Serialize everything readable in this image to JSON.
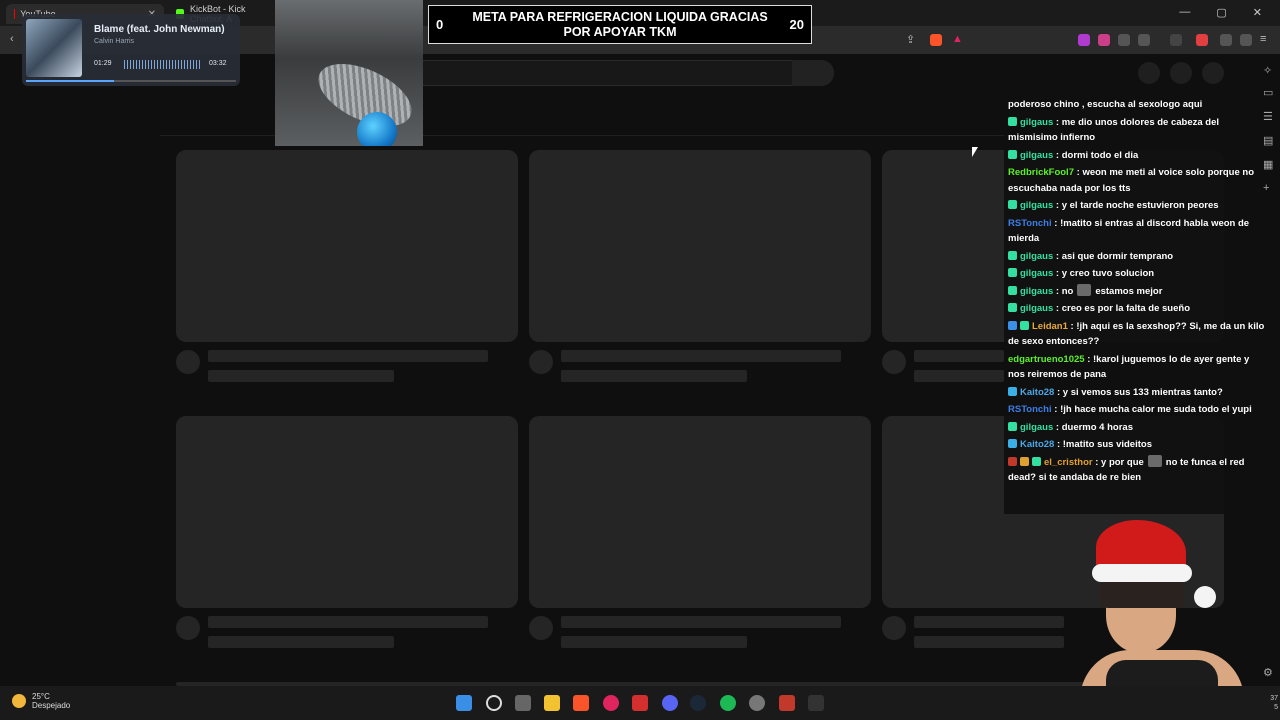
{
  "browser": {
    "tabs": [
      {
        "label": "YouTube",
        "color": "#ff0000"
      },
      {
        "label": "KickBot - Kick Chatbot, A",
        "color": "#53fc18"
      }
    ],
    "window_controls": [
      "—",
      "▢",
      "✕"
    ]
  },
  "music": {
    "title": "Blame (feat. John Newman)",
    "artist": "Calvin Harris",
    "elapsed": "01:29",
    "duration": "03:32",
    "progress": 0.42
  },
  "goal": {
    "current": "0",
    "target": "20",
    "text": "META PARA REFRIGERACION LIQUIDA GRACIAS POR APOYAR TKM"
  },
  "chat": [
    {
      "user": "",
      "color": "#ffffff",
      "badges": [],
      "text": "poderoso chino , escucha al sexologo aqui"
    },
    {
      "user": "gilgaus",
      "color": "#34e0a1",
      "badges": [
        "#34e0a1"
      ],
      "text": " : me dio unos dolores de cabeza del mismisimo infierno"
    },
    {
      "user": "gilgaus",
      "color": "#34e0a1",
      "badges": [
        "#34e0a1"
      ],
      "text": " : dormi todo el dia"
    },
    {
      "user": "RedbrickFool7",
      "color": "#5cf02b",
      "badges": [],
      "text": " : weon me meti al voice solo porque no escuchaba nada por los tts"
    },
    {
      "user": "gilgaus",
      "color": "#34e0a1",
      "badges": [
        "#34e0a1"
      ],
      "text": " : y el tarde noche estuvieron peores"
    },
    {
      "user": "RSTonchi",
      "color": "#3b7fe6",
      "badges": [],
      "text": " : !matito si entras al discord habla weon de mierda"
    },
    {
      "user": "gilgaus",
      "color": "#34e0a1",
      "badges": [
        "#34e0a1"
      ],
      "text": " : asi que dormir temprano"
    },
    {
      "user": "gilgaus",
      "color": "#34e0a1",
      "badges": [
        "#34e0a1"
      ],
      "text": " : y creo tuvo solucion"
    },
    {
      "user": "gilgaus",
      "color": "#34e0a1",
      "badges": [
        "#34e0a1"
      ],
      "text": " : no",
      "emote": true,
      "after": "estamos mejor"
    },
    {
      "user": "gilgaus",
      "color": "#34e0a1",
      "badges": [
        "#34e0a1"
      ],
      "text": " : creo es por la falta de sueño"
    },
    {
      "user": "Leidan1",
      "color": "#e7a93b",
      "badges": [
        "#3b8fe6",
        "#34e0a1"
      ],
      "text": " : !jh aqui es la sexshop?? Si, me da un kilo de sexo entonces??"
    },
    {
      "user": "edgartrueno1025",
      "color": "#5cf02b",
      "badges": [],
      "text": " : !karol juguemos lo de ayer gente y nos reiremos de pana"
    },
    {
      "user": "Kaito28",
      "color": "#4aa8e8",
      "badges": [
        "#3bb0e6"
      ],
      "text": " : y si vemos sus 133 mientras tanto?"
    },
    {
      "user": "RSTonchi",
      "color": "#3b7fe6",
      "badges": [],
      "text": " : !jh hace mucha calor me suda todo el yupi"
    },
    {
      "user": "gilgaus",
      "color": "#34e0a1",
      "badges": [
        "#34e0a1"
      ],
      "text": " : duermo 4 horas"
    },
    {
      "user": "Kaito28",
      "color": "#4aa8e8",
      "badges": [
        "#3bb0e6"
      ],
      "text": " : !matito sus videitos"
    },
    {
      "user": "el_cristhor",
      "color": "#e0a030",
      "badges": [
        "#c0392b",
        "#e0a030",
        "#34e0a1"
      ],
      "text": " : y por que",
      "emote": true,
      "after": "no te funca el red dead? si te andaba de re bien"
    }
  ],
  "weather": {
    "temp": "25°C",
    "condition": "Despejado"
  },
  "clock": {
    "line1": "37",
    "line2": "5"
  }
}
